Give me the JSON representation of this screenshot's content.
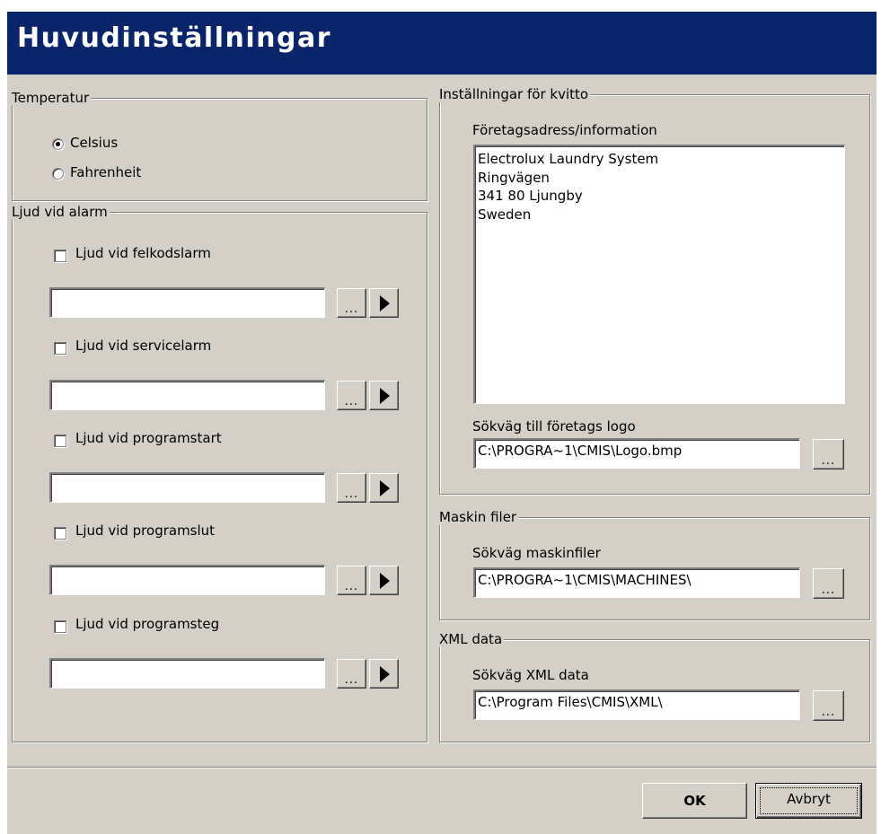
{
  "window": {
    "title": "Huvudinställningar"
  },
  "temperature": {
    "group_label": "Temperatur",
    "options": [
      {
        "label": "Celsius",
        "selected": true
      },
      {
        "label": "Fahrenheit",
        "selected": false
      }
    ]
  },
  "alarm_sounds": {
    "group_label": "Ljud vid alarm",
    "items": [
      {
        "label": "Ljud vid felkodslarm",
        "checked": false,
        "path": ""
      },
      {
        "label": "Ljud vid servicelarm",
        "checked": false,
        "path": ""
      },
      {
        "label": "Ljud vid programstart",
        "checked": false,
        "path": ""
      },
      {
        "label": "Ljud vid programslut",
        "checked": false,
        "path": ""
      },
      {
        "label": "Ljud vid programsteg",
        "checked": false,
        "path": ""
      }
    ],
    "browse_label": "...",
    "play_icon": "play-icon"
  },
  "receipt": {
    "group_label": "Inställningar för kvitto",
    "address_label": "Företagsadress/information",
    "address_lines": [
      "Electrolux Laundry System",
      "Ringvägen",
      "341 80 Ljungby",
      "Sweden"
    ],
    "logo_label": "Sökväg till företags logo",
    "logo_path": "C:\\PROGRA~1\\CMIS\\Logo.bmp",
    "browse_label": "..."
  },
  "machine_files": {
    "group_label": "Maskin filer",
    "path_label": "Sökväg maskinfiler",
    "path": "C:\\PROGRA~1\\CMIS\\MACHINES\\",
    "browse_label": "..."
  },
  "xml_data": {
    "group_label": "XML data",
    "path_label": "Sökväg XML data",
    "path": "C:\\Program Files\\CMIS\\XML\\",
    "browse_label": "..."
  },
  "footer": {
    "ok_label": "OK",
    "cancel_label": "Avbryt"
  },
  "colors": {
    "titlebar": "#0a246a",
    "face": "#d4d0c8"
  }
}
